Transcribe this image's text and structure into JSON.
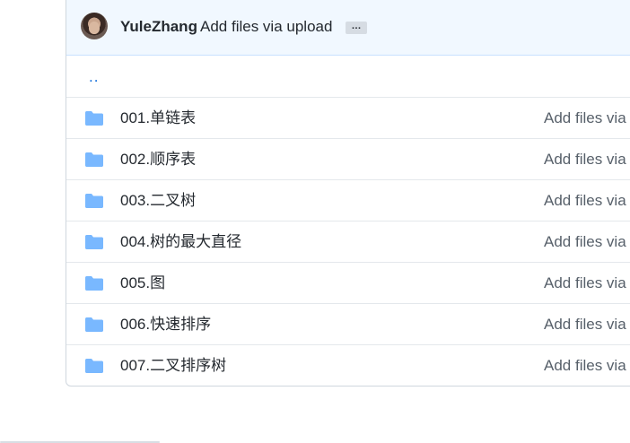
{
  "commit": {
    "author": "YuleZhang",
    "message": "Add files via upload",
    "more_label": "…"
  },
  "parent_link": "..",
  "folders": [
    {
      "name": "001.单链表",
      "commit": "Add files via"
    },
    {
      "name": "002.顺序表",
      "commit": "Add files via"
    },
    {
      "name": "003.二叉树",
      "commit": "Add files via"
    },
    {
      "name": "004.树的最大直径",
      "commit": "Add files via"
    },
    {
      "name": "005.图",
      "commit": "Add files via"
    },
    {
      "name": "006.快速排序",
      "commit": "Add files via"
    },
    {
      "name": "007.二叉排序树",
      "commit": "Add files via"
    }
  ],
  "icons": {
    "folder": "folder-icon",
    "avatar": "avatar"
  },
  "colors": {
    "folder": "#79b8ff",
    "link": "#0969da",
    "header_bg": "#f1f8ff"
  }
}
